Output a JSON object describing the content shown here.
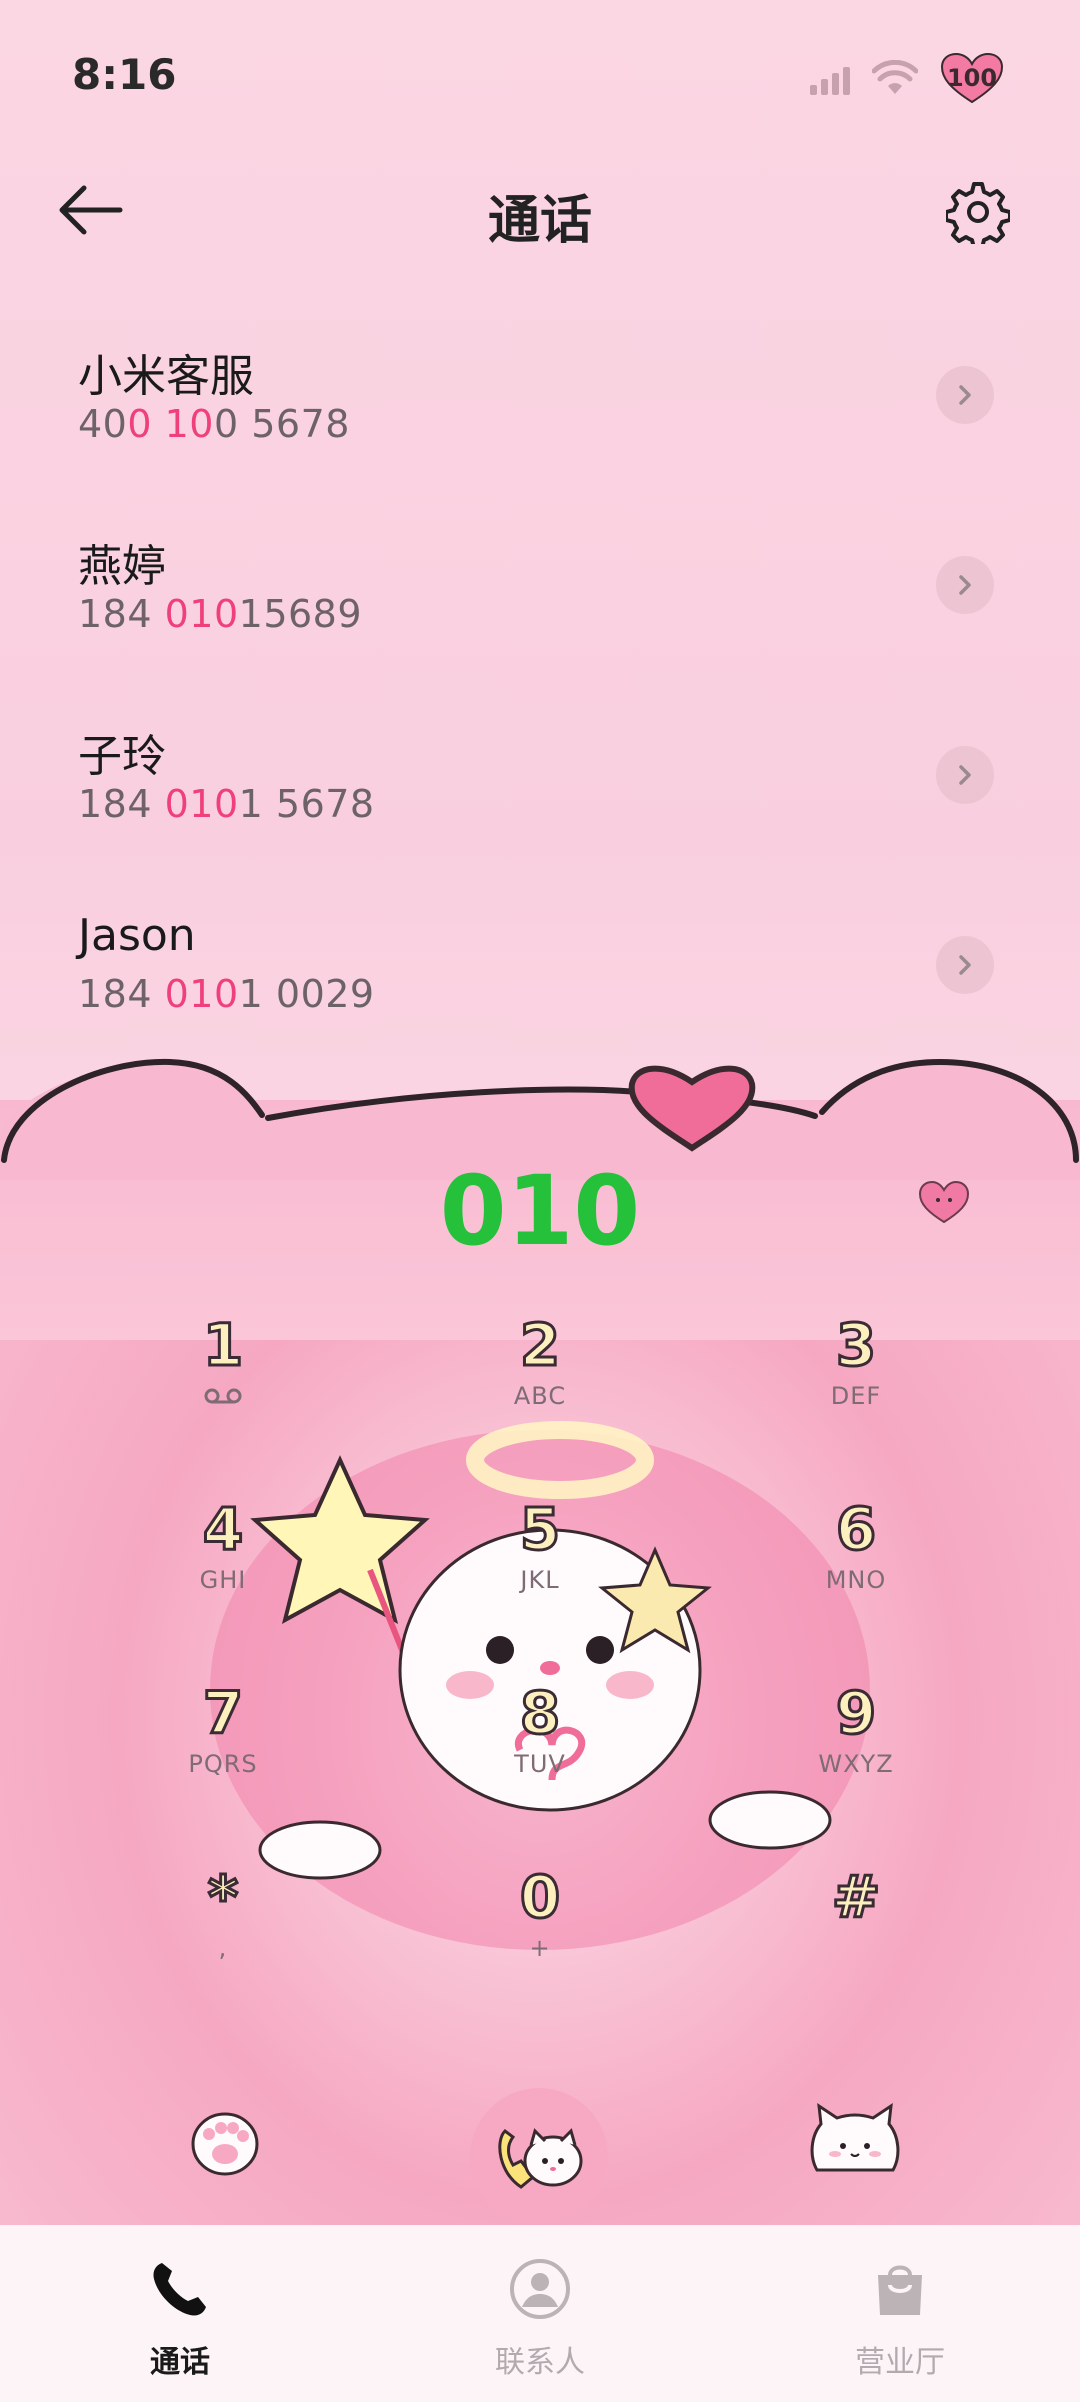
{
  "status_bar": {
    "time": "8:16",
    "battery": "100"
  },
  "header": {
    "title": "通话"
  },
  "contacts": [
    {
      "name": "小米客服",
      "number_parts": [
        "40",
        "0 10",
        "0 5678"
      ]
    },
    {
      "name": "燕婷",
      "number_parts": [
        "184 ",
        "010",
        "15689"
      ]
    },
    {
      "name": "子玲",
      "number_parts": [
        "184 ",
        "010",
        "1 5678"
      ]
    },
    {
      "name": "Jason",
      "number_parts": [
        "184 ",
        "010",
        "1 0029"
      ]
    }
  ],
  "dialer": {
    "input": "010",
    "keys": [
      {
        "digit": "1",
        "letters": ""
      },
      {
        "digit": "2",
        "letters": "ABC"
      },
      {
        "digit": "3",
        "letters": "DEF"
      },
      {
        "digit": "4",
        "letters": "GHI"
      },
      {
        "digit": "5",
        "letters": "JKL"
      },
      {
        "digit": "6",
        "letters": "MNO"
      },
      {
        "digit": "7",
        "letters": "PQRS"
      },
      {
        "digit": "8",
        "letters": "TUV"
      },
      {
        "digit": "9",
        "letters": "WXYZ"
      },
      {
        "digit": "*",
        "letters": ","
      },
      {
        "digit": "0",
        "letters": "+"
      },
      {
        "digit": "#",
        "letters": ""
      }
    ],
    "voicemail_icon": "voicemail-icon"
  },
  "bottom_nav": {
    "items": [
      {
        "label": "通话",
        "icon": "phone-icon",
        "active": true
      },
      {
        "label": "联系人",
        "icon": "person-icon",
        "active": false
      },
      {
        "label": "营业厅",
        "icon": "shopping-bag-icon",
        "active": false
      }
    ]
  },
  "colors": {
    "accent_highlight": "#f0407b",
    "dial_number": "#25c13a",
    "background": "#fbd6e3"
  }
}
